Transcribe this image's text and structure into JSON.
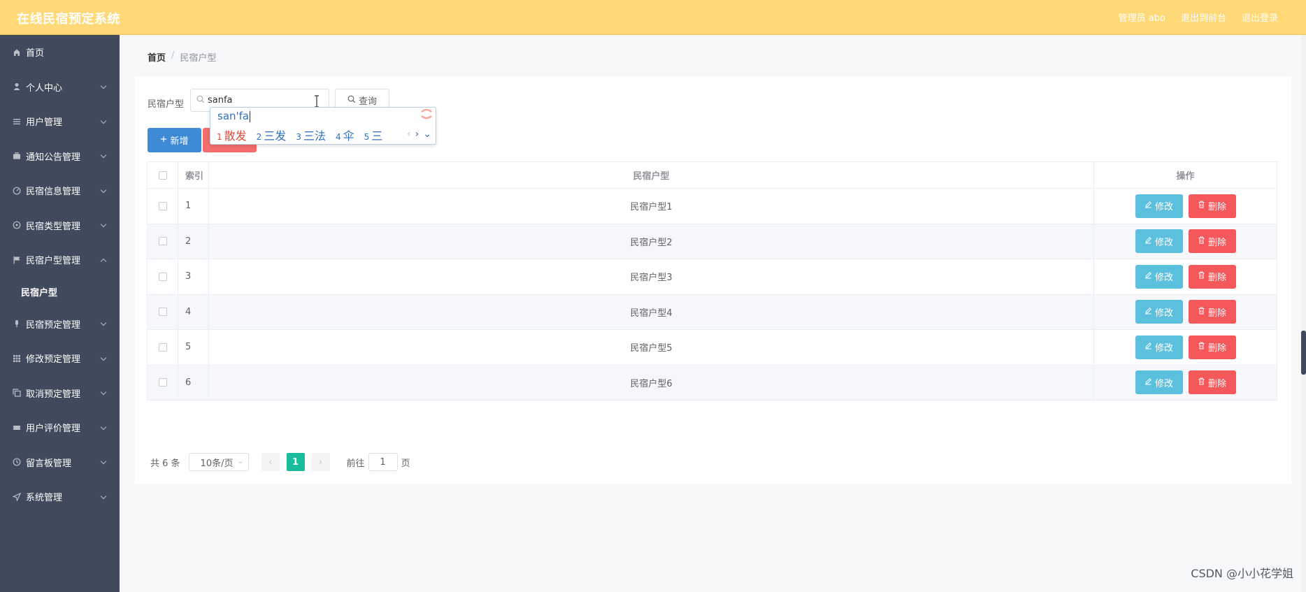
{
  "header": {
    "app_title": "在线民宿预定系统",
    "admin_label": "管理员 abo",
    "front_link": "退出到前台",
    "logout_link": "退出登录"
  },
  "sidebar": {
    "items": [
      {
        "label": "首页",
        "icon": "home-icon"
      },
      {
        "label": "个人中心",
        "icon": "user-icon"
      },
      {
        "label": "用户管理",
        "icon": "list-icon"
      },
      {
        "label": "通知公告管理",
        "icon": "briefcase-icon"
      },
      {
        "label": "民宿信息管理",
        "icon": "gauge-icon"
      },
      {
        "label": "民宿类型管理",
        "icon": "compass-icon"
      },
      {
        "label": "民宿户型管理",
        "icon": "flag-icon"
      },
      {
        "label": "民宿预定管理",
        "icon": "mic-icon"
      },
      {
        "label": "修改预定管理",
        "icon": "grid-icon"
      },
      {
        "label": "取消预定管理",
        "icon": "copy-icon"
      },
      {
        "label": "用户评价管理",
        "icon": "ticket-icon"
      },
      {
        "label": "留言板管理",
        "icon": "clock-icon"
      },
      {
        "label": "系统管理",
        "icon": "send-icon"
      }
    ],
    "active_sub": "民宿户型"
  },
  "breadcrumb": {
    "home": "首页",
    "sep": "/",
    "current": "民宿户型"
  },
  "search": {
    "label": "民宿户型",
    "value": "sanfa",
    "query_button": "查询",
    "add_button": "新增"
  },
  "ime": {
    "composition": "san'fa",
    "candidates": [
      {
        "num": "1",
        "text": "散发"
      },
      {
        "num": "2",
        "text": "三发"
      },
      {
        "num": "3",
        "text": "三法"
      },
      {
        "num": "4",
        "text": "伞"
      },
      {
        "num": "5",
        "text": "三"
      }
    ],
    "prev": "‹",
    "next": "›",
    "more": "⌄"
  },
  "table": {
    "headers": {
      "index": "索引",
      "name": "民宿户型",
      "ops": "操作"
    },
    "rows": [
      {
        "index": "1",
        "name": "民宿户型1"
      },
      {
        "index": "2",
        "name": "民宿户型2"
      },
      {
        "index": "3",
        "name": "民宿户型3"
      },
      {
        "index": "4",
        "name": "民宿户型4"
      },
      {
        "index": "5",
        "name": "民宿户型5"
      },
      {
        "index": "6",
        "name": "民宿户型6"
      }
    ],
    "edit_label": "修改",
    "delete_label": "删除"
  },
  "pagination": {
    "total": "共 6 条",
    "page_size": "10条/页",
    "current_page": "1",
    "goto_label": "前往",
    "goto_value": "1",
    "page_suffix": "页"
  },
  "watermark": "CSDN @小小花学姐",
  "colors": {
    "header_bg": "#ffd977",
    "sidebar_bg": "#404a5c",
    "primary": "#3e8ad4",
    "edit": "#5bc0de",
    "danger": "#f5585b",
    "page_active": "#1abc9c"
  }
}
